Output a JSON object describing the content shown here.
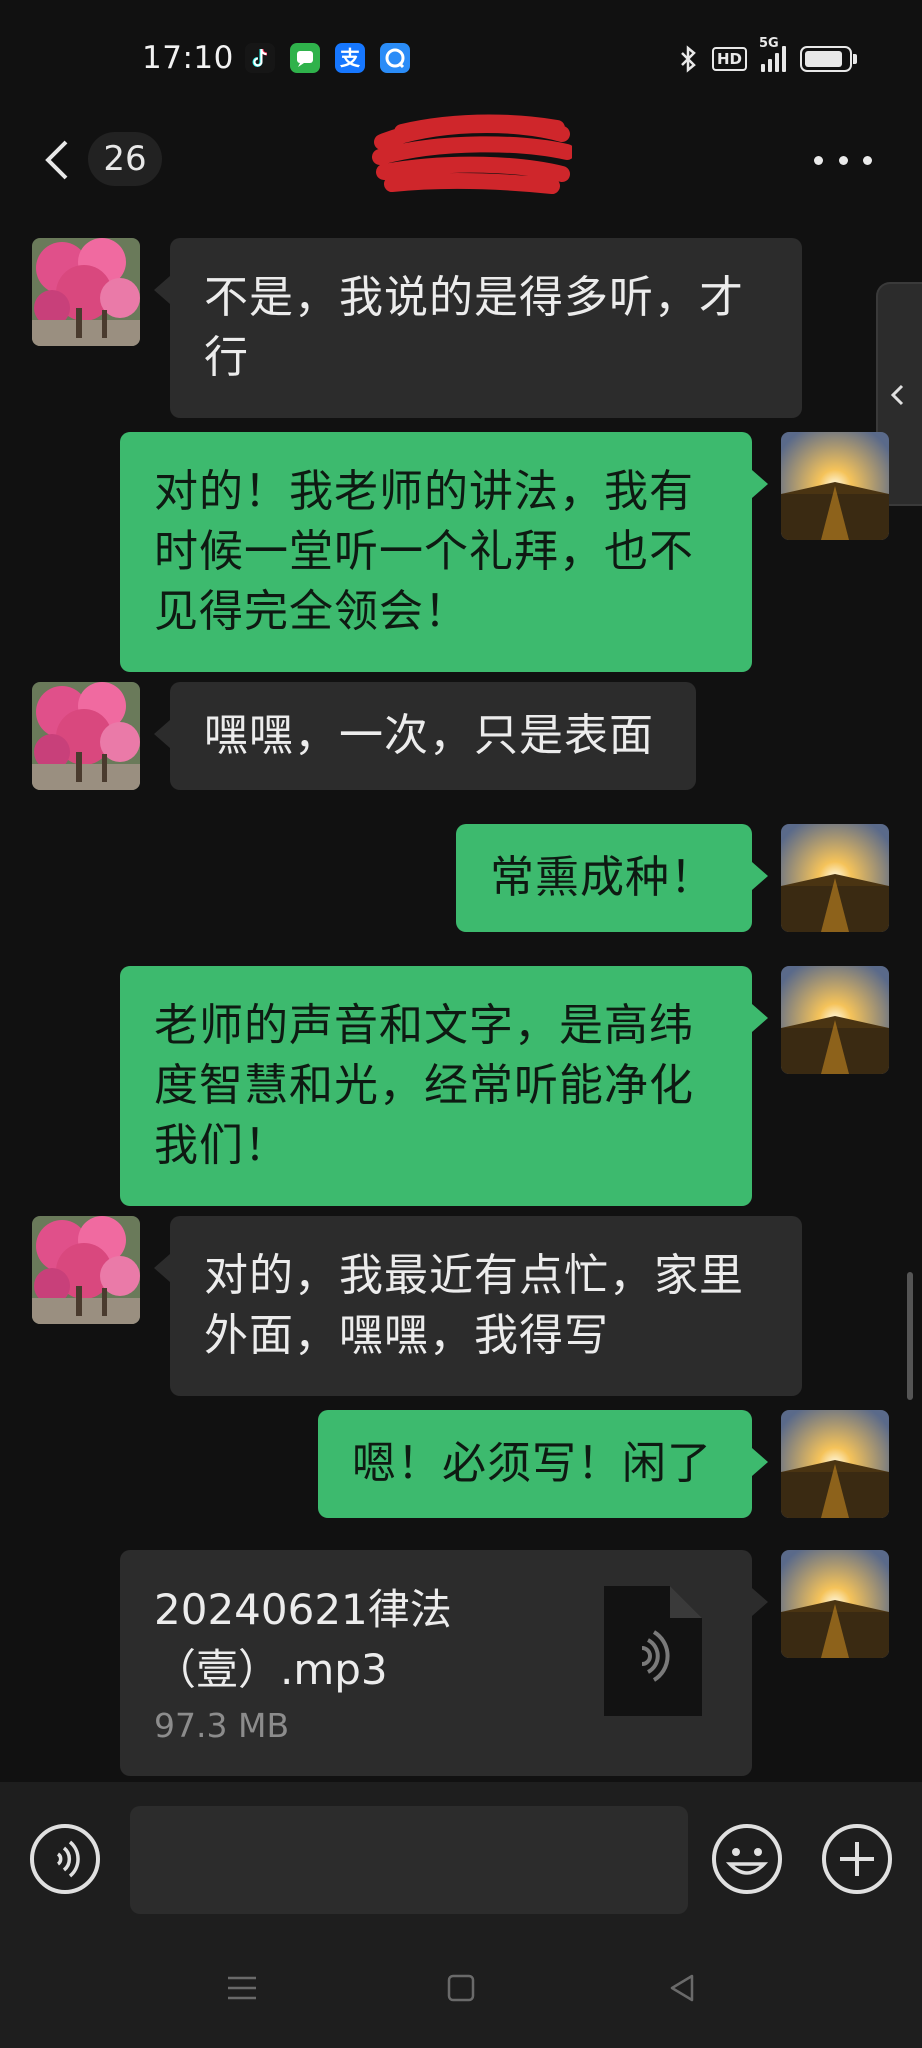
{
  "status_bar": {
    "time": "17:10",
    "apps": [
      "tiktok-icon",
      "messages-icon",
      "alipay-icon",
      "qq-browser-icon"
    ],
    "alipay_glyph": "支",
    "hd": "HD",
    "network": "5G",
    "icons": [
      "bluetooth-icon",
      "signal-icon",
      "battery-icon"
    ]
  },
  "header": {
    "unread_count": "26",
    "title_redacted": true
  },
  "messages": [
    {
      "side": "left",
      "text": "不是，我说的是得多听，才行"
    },
    {
      "side": "right",
      "text": "对的！我老师的讲法，我有时候一堂听一个礼拜，也不见得完全领会！"
    },
    {
      "side": "left",
      "text": "嘿嘿，一次，只是表面"
    },
    {
      "side": "right",
      "text": "常熏成种！"
    },
    {
      "side": "right",
      "text": "老师的声音和文字，是高纬度智慧和光，经常听能净化我们！"
    },
    {
      "side": "left",
      "text": "对的，我最近有点忙，家里外面，嘿嘿，我得写"
    },
    {
      "side": "right",
      "text": "嗯！必须写！闲了"
    }
  ],
  "file_message": {
    "side": "right",
    "name_line1": "20240621律法",
    "name_line2": "（壹）.mp3",
    "size": "97.3 MB",
    "icon": "audio-file-icon"
  },
  "input_bar": {
    "placeholder": "",
    "icons": [
      "voice-icon",
      "emoji-icon",
      "plus-icon"
    ]
  },
  "colors": {
    "background": "#111111",
    "bubble_right": "#3dba6e",
    "bubble_left": "#2c2c2c"
  }
}
